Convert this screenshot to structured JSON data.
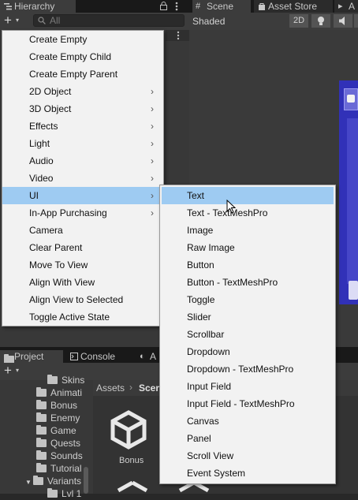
{
  "hierarchy": {
    "tab_label": "Hierarchy",
    "add_label": "+",
    "search_placeholder": "All"
  },
  "scene": {
    "tabs": [
      {
        "label": "Scene",
        "icon": "hash-grid-icon"
      },
      {
        "label": "Asset Store",
        "icon": "shopping-bag-icon"
      },
      {
        "label": "A",
        "icon": "animation-icon"
      }
    ],
    "shading_mode": "Shaded",
    "mode_2d": "2D"
  },
  "context_menu": {
    "items": [
      {
        "label": "Create Empty",
        "submenu": false
      },
      {
        "label": "Create Empty Child",
        "submenu": false
      },
      {
        "label": "Create Empty Parent",
        "submenu": false
      },
      {
        "label": "2D Object",
        "submenu": true
      },
      {
        "label": "3D Object",
        "submenu": true
      },
      {
        "label": "Effects",
        "submenu": true
      },
      {
        "label": "Light",
        "submenu": true
      },
      {
        "label": "Audio",
        "submenu": true
      },
      {
        "label": "Video",
        "submenu": true
      },
      {
        "label": "UI",
        "submenu": true,
        "highlighted": true
      },
      {
        "label": "In-App Purchasing",
        "submenu": true
      },
      {
        "label": "Camera",
        "submenu": false
      },
      {
        "label": "Clear Parent",
        "submenu": false
      },
      {
        "label": "Move To View",
        "submenu": false
      },
      {
        "label": "Align With View",
        "submenu": false
      },
      {
        "label": "Align View to Selected",
        "submenu": false
      },
      {
        "label": "Toggle Active State",
        "submenu": false
      }
    ]
  },
  "ui_submenu": {
    "items": [
      {
        "label": "Text",
        "highlighted": true
      },
      {
        "label": "Text - TextMeshPro"
      },
      {
        "label": "Image"
      },
      {
        "label": "Raw Image"
      },
      {
        "label": "Button"
      },
      {
        "label": "Button - TextMeshPro"
      },
      {
        "label": "Toggle"
      },
      {
        "label": "Slider"
      },
      {
        "label": "Scrollbar"
      },
      {
        "label": "Dropdown"
      },
      {
        "label": "Dropdown - TextMeshPro"
      },
      {
        "label": "Input Field"
      },
      {
        "label": "Input Field - TextMeshPro"
      },
      {
        "label": "Canvas"
      },
      {
        "label": "Panel"
      },
      {
        "label": "Scroll View"
      },
      {
        "label": "Event System"
      }
    ]
  },
  "project": {
    "tabs": [
      {
        "label": "Project",
        "icon": "folder-icon"
      },
      {
        "label": "Console",
        "icon": "console-icon"
      },
      {
        "label": "A",
        "icon": "animation-icon"
      }
    ],
    "add_label": "+",
    "tree": [
      {
        "label": "Skins",
        "indent": 1
      },
      {
        "label": "Animati",
        "indent": 0
      },
      {
        "label": "Bonus",
        "indent": 0
      },
      {
        "label": "Enemy",
        "indent": 0
      },
      {
        "label": "Game",
        "indent": 0
      },
      {
        "label": "Quests",
        "indent": 0
      },
      {
        "label": "Sounds",
        "indent": 0
      },
      {
        "label": "Tutorial",
        "indent": 0
      },
      {
        "label": "Variants",
        "indent": -1
      },
      {
        "label": "Lvl 1",
        "indent": 1
      }
    ],
    "breadcrumb": [
      "Assets",
      "Scen"
    ],
    "asset_label": "Bonus"
  },
  "colors": {
    "menu_bg": "#f2f2f2",
    "highlight": "#9ecbf2",
    "scene_blue": "#3131b8"
  }
}
